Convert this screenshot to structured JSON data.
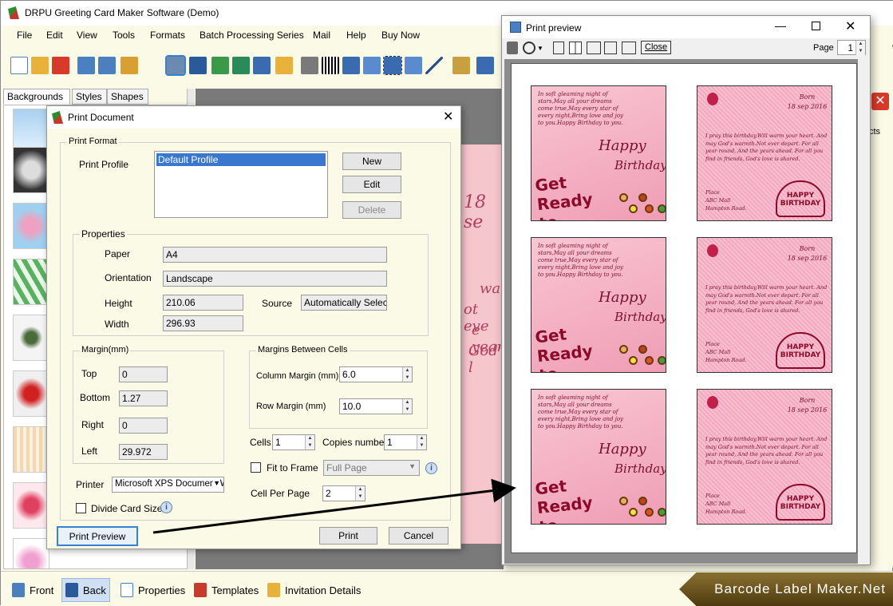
{
  "main": {
    "title": "DRPU Greeting Card Maker Software (Demo)",
    "menu": [
      "File",
      "Edit",
      "View",
      "Tools",
      "Formats",
      "Batch Processing Series",
      "Mail",
      "Help",
      "Buy Now"
    ],
    "left_tabs": [
      "Backgrounds",
      "Styles",
      "Shapes"
    ],
    "canvas_text": {
      "date": "18 se",
      "l1": "warm",
      "l2": "ot eve",
      "l3": "e year",
      "l4": "God's l"
    },
    "bottom": {
      "front": "Front",
      "back": "Back",
      "properties": "Properties",
      "templates": "Templates",
      "invitation": "Invitation Details"
    },
    "brand": "Barcode Label Maker.Net",
    "right_partial": "cts"
  },
  "print_document": {
    "title": "Print Document",
    "print_format": "Print Format",
    "print_profile_label": "Print Profile",
    "profile_selected": "Default Profile",
    "new_btn": "New",
    "edit_btn": "Edit",
    "delete_btn": "Delete",
    "properties_label": "Properties",
    "paper_label": "Paper",
    "paper_value": "A4",
    "orientation_label": "Orientation",
    "orientation_value": "Landscape",
    "height_label": "Height",
    "height_value": "210.06",
    "width_label": "Width",
    "width_value": "296.93",
    "source_label": "Source",
    "source_value": "Automatically Select",
    "margin_label": "Margin(mm)",
    "top_label": "Top",
    "top_value": "0",
    "bottom_label": "Bottom",
    "bottom_value": "1.27",
    "right_label": "Right",
    "right_value": "0",
    "left_label": "Left",
    "left_value": "29.972",
    "mbc_label": "Margins Between Cells",
    "col_margin_label": "Column Margin (mm)",
    "col_margin_value": "6.0",
    "row_margin_label": "Row Margin (mm)",
    "row_margin_value": "10.0",
    "cells_label": "Cells",
    "cells_value": "1",
    "copies_label": "Copies number",
    "copies_value": "1",
    "fit_label": "Fit to Frame",
    "fit_value": "Full Page",
    "cell_per_page_label": "Cell Per Page",
    "cell_per_page_value": "2",
    "printer_label": "Printer",
    "printer_value": "Microsoft XPS Document Writer",
    "divide_label": "Divide Card Size",
    "print_preview_btn": "Print Preview",
    "print_btn": "Print",
    "cancel_btn": "Cancel"
  },
  "preview": {
    "title": "Print preview",
    "close_btn": "Close",
    "page_label": "Page",
    "page_value": "1",
    "card_left": {
      "verse": "In soft gleaming night of stars,May all your dreams come true,May every star of every night,Bring love and joy to you.Happy Birthday to you.",
      "happy": "Happy",
      "birthday": "Birthday",
      "party": "Get Ready to PARTY"
    },
    "card_right": {
      "born": "Born",
      "date": "18 sep  2016",
      "verse": "I pray this birthday,Will warm your heart. And may God's warmth.Not ever depart. For all year round, And the years ahead. For all you find in friends, God's love is shared.",
      "place": "Place",
      "venue": "ABC Mall",
      "road": "Hampton Road.",
      "cake": "HAPPY BIRTHDAY"
    }
  }
}
